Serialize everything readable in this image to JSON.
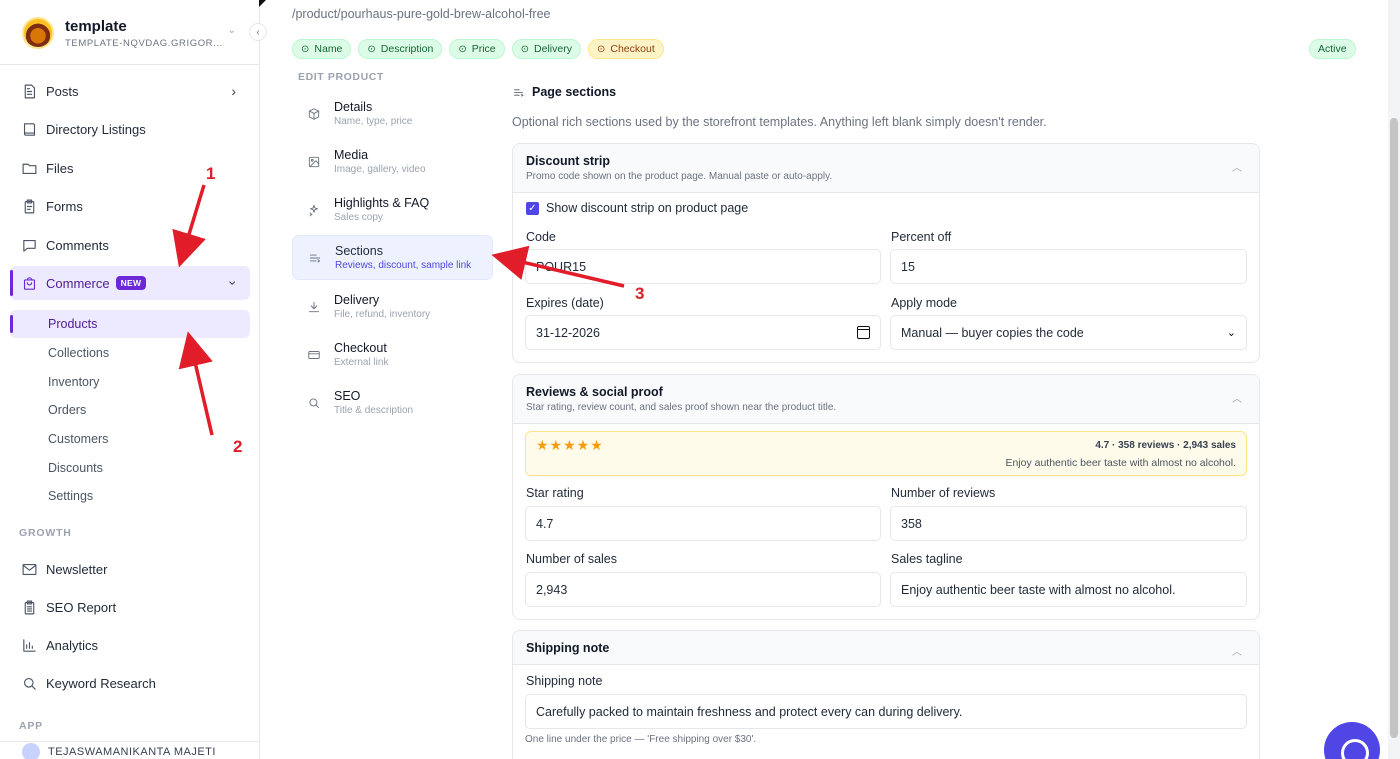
{
  "workspace": {
    "name": "template",
    "subtitle": "TEMPLATE-NQVDAG.GRIGOR..."
  },
  "sidebar": {
    "items": [
      {
        "label": "Posts",
        "icon": "document-icon"
      },
      {
        "label": "Directory Listings",
        "icon": "book-icon"
      },
      {
        "label": "Files",
        "icon": "folder-icon"
      },
      {
        "label": "Forms",
        "icon": "clipboard-icon"
      },
      {
        "label": "Comments",
        "icon": "chat-icon"
      },
      {
        "label": "Commerce",
        "icon": "shopping-bag-icon",
        "badge": "NEW"
      }
    ],
    "commerce_sub": [
      "Products",
      "Collections",
      "Inventory",
      "Orders",
      "Customers",
      "Discounts",
      "Settings"
    ],
    "growth_label": "GROWTH",
    "growth_items": [
      {
        "label": "Newsletter",
        "icon": "mail-icon"
      },
      {
        "label": "SEO Report",
        "icon": "clipboard-list-icon"
      },
      {
        "label": "Analytics",
        "icon": "bar-chart-icon"
      },
      {
        "label": "Keyword Research",
        "icon": "search-icon"
      }
    ],
    "app_label": "APP",
    "user": "TEJASWAMANIKANTA MAJETI"
  },
  "product": {
    "slug": "/product/pourhaus-pure-gold-brew-alcohol-free",
    "chips": [
      {
        "label": "Name",
        "state": "done"
      },
      {
        "label": "Description",
        "state": "done"
      },
      {
        "label": "Price",
        "state": "done"
      },
      {
        "label": "Delivery",
        "state": "done"
      },
      {
        "label": "Checkout",
        "state": "warning"
      }
    ],
    "status": "Active"
  },
  "edit_nav": {
    "label": "EDIT PRODUCT",
    "items": [
      {
        "title": "Details",
        "sub": "Name, type, price",
        "icon": "cube-icon"
      },
      {
        "title": "Media",
        "sub": "Image, gallery, video",
        "icon": "image-icon"
      },
      {
        "title": "Highlights & FAQ",
        "sub": "Sales copy",
        "icon": "sparkles-icon"
      },
      {
        "title": "Sections",
        "sub": "Reviews, discount, sample link",
        "icon": "sections-icon",
        "active": true
      },
      {
        "title": "Delivery",
        "sub": "File, refund, inventory",
        "icon": "download-icon"
      },
      {
        "title": "Checkout",
        "sub": "External link",
        "icon": "credit-card-icon"
      },
      {
        "title": "SEO",
        "sub": "Title & description",
        "icon": "search-icon"
      }
    ]
  },
  "page_sections": {
    "title": "Page sections",
    "description": "Optional rich sections used by the storefront templates. Anything left blank simply doesn't render."
  },
  "discount": {
    "title": "Discount strip",
    "subtitle": "Promo code shown on the product page. Manual paste or auto-apply.",
    "show_label": "Show discount strip on product page",
    "code_label": "Code",
    "code_value": "POUR15",
    "percent_label": "Percent off",
    "percent_value": "15",
    "expires_label": "Expires (date)",
    "expires_value": "31-12-2026",
    "mode_label": "Apply mode",
    "mode_value": "Manual — buyer copies the code"
  },
  "reviews": {
    "title": "Reviews & social proof",
    "subtitle": "Star rating, review count, and sales proof shown near the product title.",
    "preview_stats": "4.7 · 358 reviews · 2,943 sales",
    "preview_tagline": "Enjoy authentic beer taste with almost no alcohol.",
    "rating_stars": 4.7,
    "star_label": "Star rating",
    "star_value": "4.7",
    "num_reviews_label": "Number of reviews",
    "num_reviews_value": "358",
    "num_sales_label": "Number of sales",
    "num_sales_value": "2,943",
    "tagline_label": "Sales tagline",
    "tagline_value": "Enjoy authentic beer taste with almost no alcohol."
  },
  "shipping": {
    "title": "Shipping note",
    "field_label": "Shipping note",
    "field_value": "Carefully packed to maintain freshness and protect every can during delivery.",
    "hint": "One line under the price — 'Free shipping over $30'."
  },
  "annotations": [
    "1",
    "2",
    "3"
  ],
  "colors": {
    "accent": "#6d28d9",
    "annotation": "#e11d2a",
    "star": "#f59e0b"
  }
}
